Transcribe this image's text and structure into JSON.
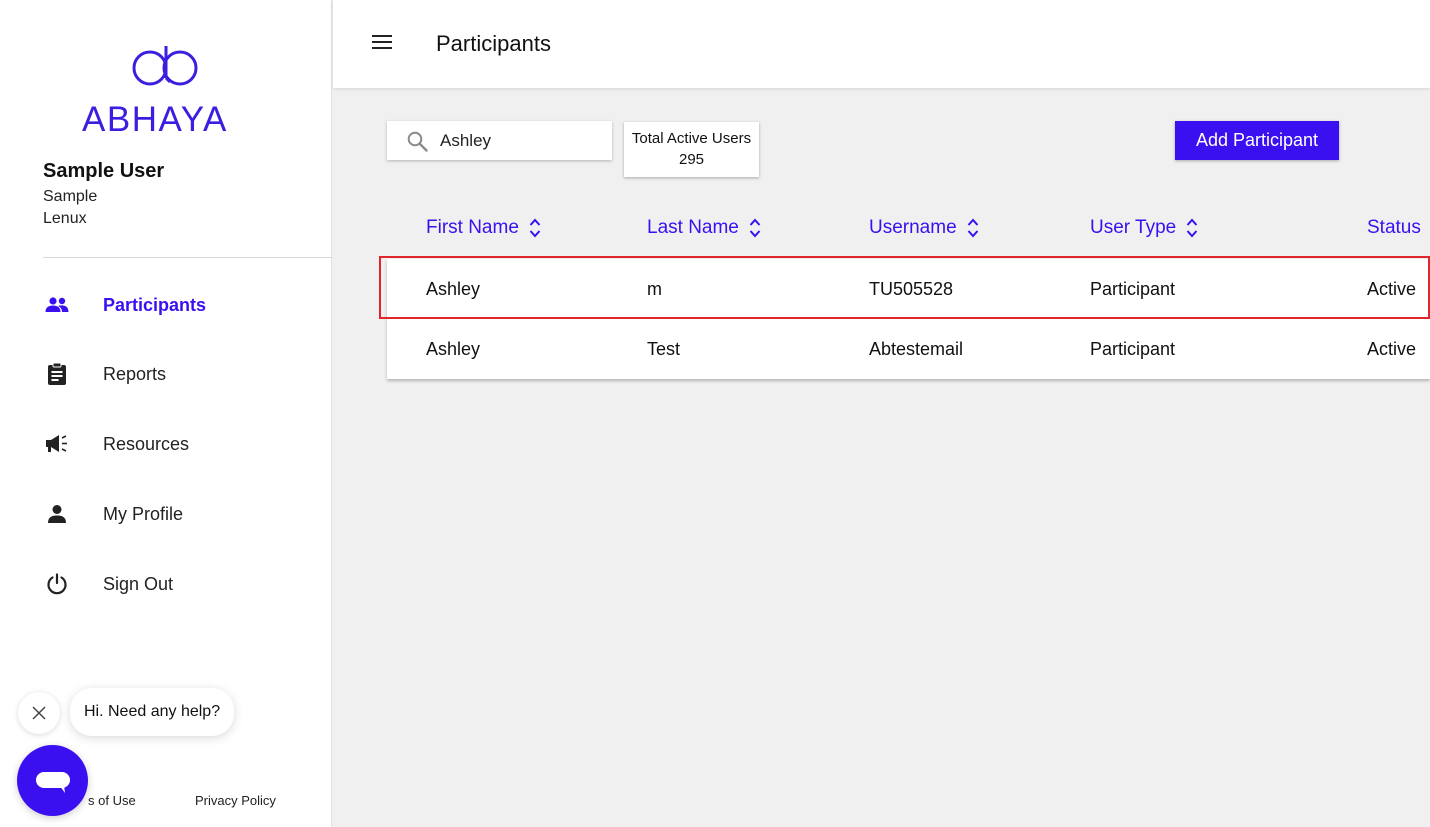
{
  "brand": {
    "name": "ABHAYA",
    "accent_color": "#3b10f0"
  },
  "user": {
    "name": "Sample User",
    "line1": "Sample",
    "line2": "Lenux"
  },
  "nav": {
    "items": [
      {
        "label": "Participants",
        "icon": "people-icon",
        "active": true
      },
      {
        "label": "Reports",
        "icon": "clipboard-icon",
        "active": false
      },
      {
        "label": "Resources",
        "icon": "megaphone-icon",
        "active": false
      },
      {
        "label": "My Profile",
        "icon": "person-icon",
        "active": false
      },
      {
        "label": "Sign Out",
        "icon": "power-icon",
        "active": false
      }
    ]
  },
  "footer": {
    "terms": "s of Use",
    "privacy": "Privacy Policy"
  },
  "chat": {
    "message": "Hi. Need any help?"
  },
  "header": {
    "title": "Participants"
  },
  "search": {
    "value": "Ashley"
  },
  "stats": {
    "label": "Total Active Users",
    "value": "295"
  },
  "actions": {
    "add_label": "Add Participant"
  },
  "table": {
    "columns": [
      "First Name",
      "Last Name",
      "Username",
      "User Type",
      "Status"
    ],
    "rows": [
      [
        "Ashley",
        "m",
        "TU505528",
        "Participant",
        "Active"
      ],
      [
        "Ashley",
        "Test",
        "Abtestemail",
        "Participant",
        "Active"
      ]
    ],
    "highlighted_row": 0,
    "highlight_color": "#e0262b"
  }
}
